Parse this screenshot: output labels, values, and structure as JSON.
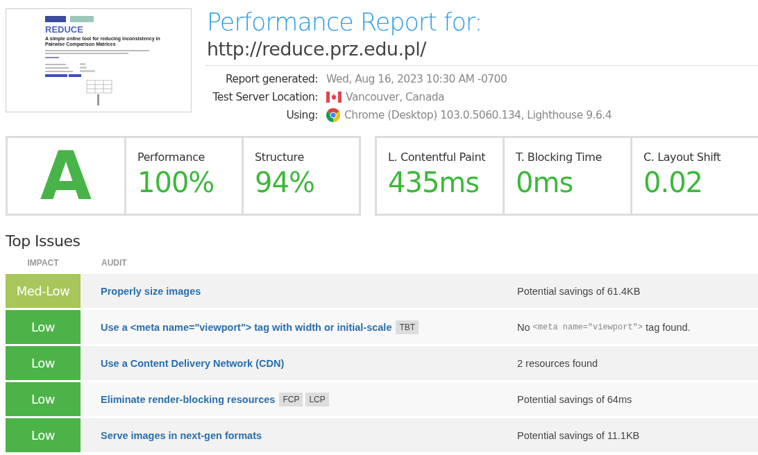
{
  "thumbnail": {
    "title": "REDUCE",
    "subtitle": "A simple online tool for reducing inconsistency in Pairwise Comparison Matrices"
  },
  "report": {
    "heading": "Performance Report for:",
    "url": "http://reduce.prz.edu.pl/",
    "info": [
      {
        "label": "Report generated:",
        "value": "Wed, Aug 16, 2023 10:30 AM -0700",
        "kind": "text"
      },
      {
        "label": "Test Server Location:",
        "value": "Vancouver, Canada",
        "kind": "flag"
      },
      {
        "label": "Using:",
        "value": "Chrome (Desktop) 103.0.5060.134, Lighthouse 9.6.4",
        "kind": "browser"
      }
    ]
  },
  "grade": {
    "letter": "A"
  },
  "scores": [
    {
      "label": "Performance",
      "value": "100%"
    },
    {
      "label": "Structure",
      "value": "94%"
    }
  ],
  "vitals": [
    {
      "label": "L. Contentful Paint",
      "value": "435ms"
    },
    {
      "label": "T. Blocking Time",
      "value": "0ms"
    },
    {
      "label": "C. Layout Shift",
      "value": "0.02"
    }
  ],
  "top_issues": {
    "title": "Top Issues",
    "columns": [
      "IMPACT",
      "AUDIT"
    ],
    "rows": [
      {
        "impact": "Med-Low",
        "color": "#a8c65a",
        "audit": "Properly size images",
        "tags": [],
        "details": [
          {
            "kind": "text",
            "text": "Potential savings of 61.4KB"
          }
        ]
      },
      {
        "impact": "Low",
        "color": "#4cb348",
        "audit": "Use a <meta name=\"viewport\"> tag with width or initial-scale",
        "tags": [
          "TBT"
        ],
        "details": [
          {
            "kind": "text",
            "text": "No "
          },
          {
            "kind": "code",
            "text": "<meta name=\"viewport\">"
          },
          {
            "kind": "text",
            "text": " tag found."
          }
        ]
      },
      {
        "impact": "Low",
        "color": "#4cb348",
        "audit": "Use a Content Delivery Network (CDN)",
        "tags": [],
        "details": [
          {
            "kind": "text",
            "text": "2 resources found"
          }
        ]
      },
      {
        "impact": "Low",
        "color": "#4cb348",
        "audit": "Eliminate render-blocking resources",
        "tags": [
          "FCP",
          "LCP"
        ],
        "details": [
          {
            "kind": "text",
            "text": "Potential savings of 64ms"
          }
        ]
      },
      {
        "impact": "Low",
        "color": "#4cb348",
        "audit": "Serve images in next-gen formats",
        "tags": [],
        "details": [
          {
            "kind": "text",
            "text": "Potential savings of 11.1KB"
          }
        ]
      }
    ]
  }
}
